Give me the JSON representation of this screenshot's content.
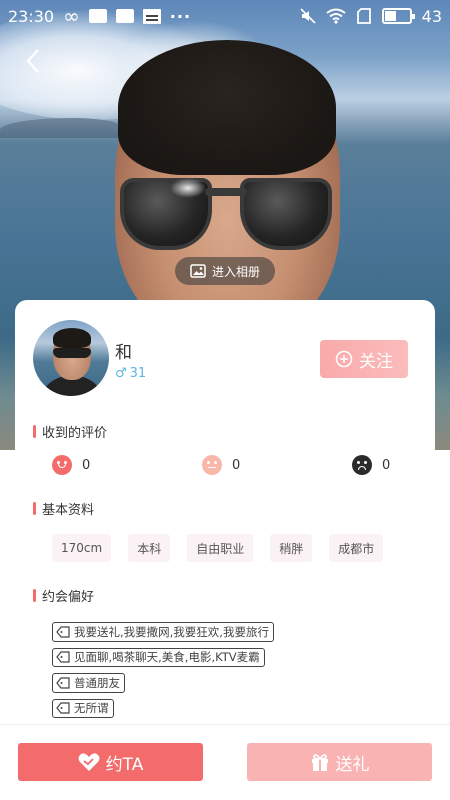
{
  "status_bar": {
    "time": "23:30",
    "infinity": "∞",
    "dots": "···",
    "battery_level": 43,
    "battery_text": "43"
  },
  "hero": {
    "album_label": "进入相册"
  },
  "profile": {
    "name": "和",
    "gender_symbol": "♂",
    "age": "31",
    "follow_label": "关注"
  },
  "reviews": {
    "title": "收到的评价",
    "items": [
      {
        "icon": "good-face-icon",
        "count": "0",
        "color": "#f36b6b"
      },
      {
        "icon": "neutral-face-icon",
        "count": "0",
        "color": "#f9b7a9"
      },
      {
        "icon": "bad-face-icon",
        "count": "0",
        "color": "#2b2b2b"
      }
    ]
  },
  "basic_info": {
    "title": "基本资料",
    "tags": [
      "170cm",
      "本科",
      "自由职业",
      "稍胖",
      "成都市"
    ]
  },
  "dating_pref": {
    "title": "约会偏好",
    "items": [
      "我要送礼,我要撒网,我要狂欢,我要旅行",
      "见面聊,喝茶聊天,美食,电影,KTV麦霸",
      "普通朋友",
      "无所谓"
    ]
  },
  "bottom": {
    "date_label": "约TA",
    "gift_label": "送礼"
  },
  "colors": {
    "accent": "#f36b6b",
    "accent_light": "#f9b3b3",
    "male_blue": "#5ab6e8",
    "tag_bg": "#fbf2f6"
  }
}
